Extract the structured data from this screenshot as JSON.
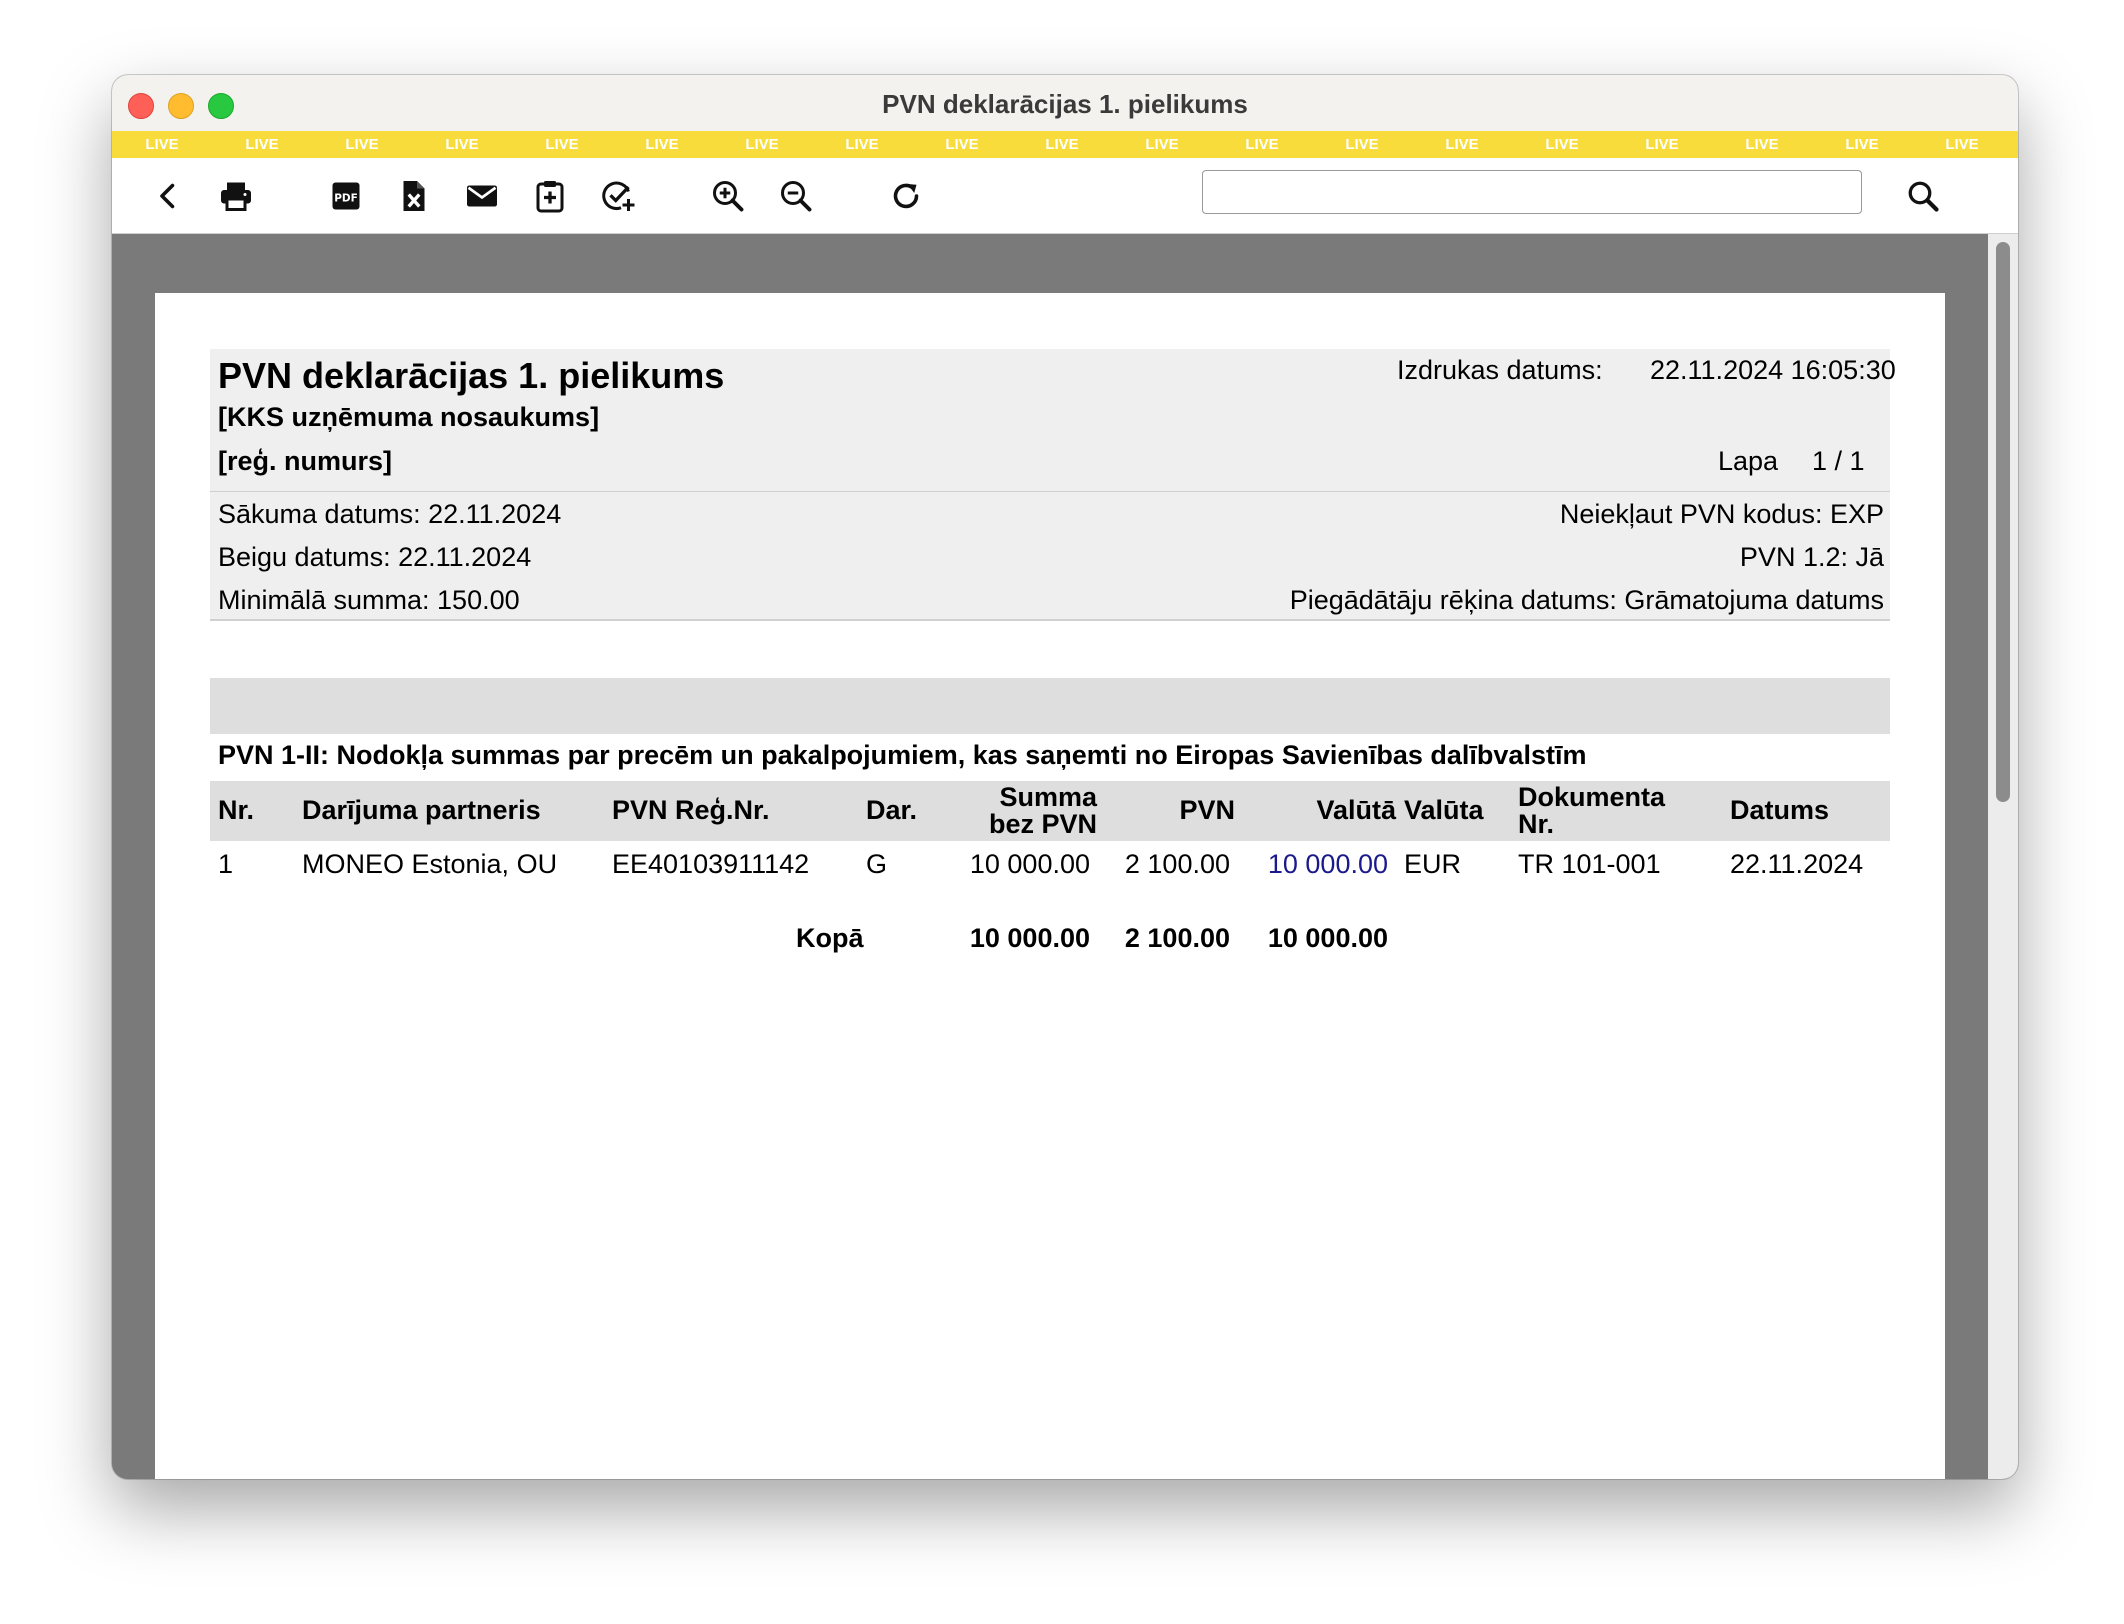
{
  "window": {
    "title": "PVN deklarācijas 1. pielikums"
  },
  "live_banner": {
    "label": "LIVE"
  },
  "toolbar": {
    "icons": [
      "back-icon",
      "print-icon",
      "pdf-icon",
      "excel-icon",
      "email-icon",
      "clipboard-add-icon",
      "check-add-icon",
      "zoom-in-icon",
      "zoom-out-icon",
      "refresh-icon",
      "search-icon"
    ],
    "search_value": ""
  },
  "report": {
    "title": "PVN deklarācijas 1. pielikums",
    "company": "[KKS uzņēmuma nosaukums]",
    "reg_number": "[reģ. numurs]",
    "print_date_label": "Izdrukas datums:",
    "print_date_value": "22.11.2024 16:05:30",
    "page_label": "Lapa",
    "page_value": "1 / 1",
    "start_date": "Sākuma datums: 22.11.2024",
    "end_date": "Beigu datums: 22.11.2024",
    "min_sum": "Minimālā summa: 150.00",
    "exclude_codes": "Neiekļaut PVN kodus: EXP",
    "pvn12": "PVN 1.2: Jā",
    "supplier_invoice_date": "Piegādātāju rēķina datums: Grāmatojuma datums"
  },
  "section": {
    "title": "PVN 1-II: Nodokļa summas par precēm un pakalpojumiem, kas saņemti no Eiropas Savienības dalībvalstīm"
  },
  "table": {
    "headers": {
      "nr": "Nr.",
      "partner": "Darījuma partneris",
      "reg": "PVN Reģ.Nr.",
      "dar": "Dar.",
      "sum_line1": "Summa",
      "sum_line2": "bez PVN",
      "pvn": "PVN",
      "valuta_amount": "Valūtā",
      "currency": "Valūta",
      "doc_line1": "Dokumenta",
      "doc_line2": "Nr.",
      "date": "Datums"
    },
    "rows": [
      {
        "nr": "1",
        "partner": "MONEO Estonia, OU",
        "reg": "EE40103911142",
        "dar": "G",
        "sum": "10 000.00",
        "pvn": "2 100.00",
        "valuta_amount": "10 000.00",
        "currency": "EUR",
        "doc": "TR 101-001",
        "date": "22.11.2024"
      }
    ],
    "totals": {
      "label": "Kopā",
      "sum": "10 000.00",
      "pvn": "2 100.00",
      "valuta_amount": "10 000.00"
    }
  }
}
